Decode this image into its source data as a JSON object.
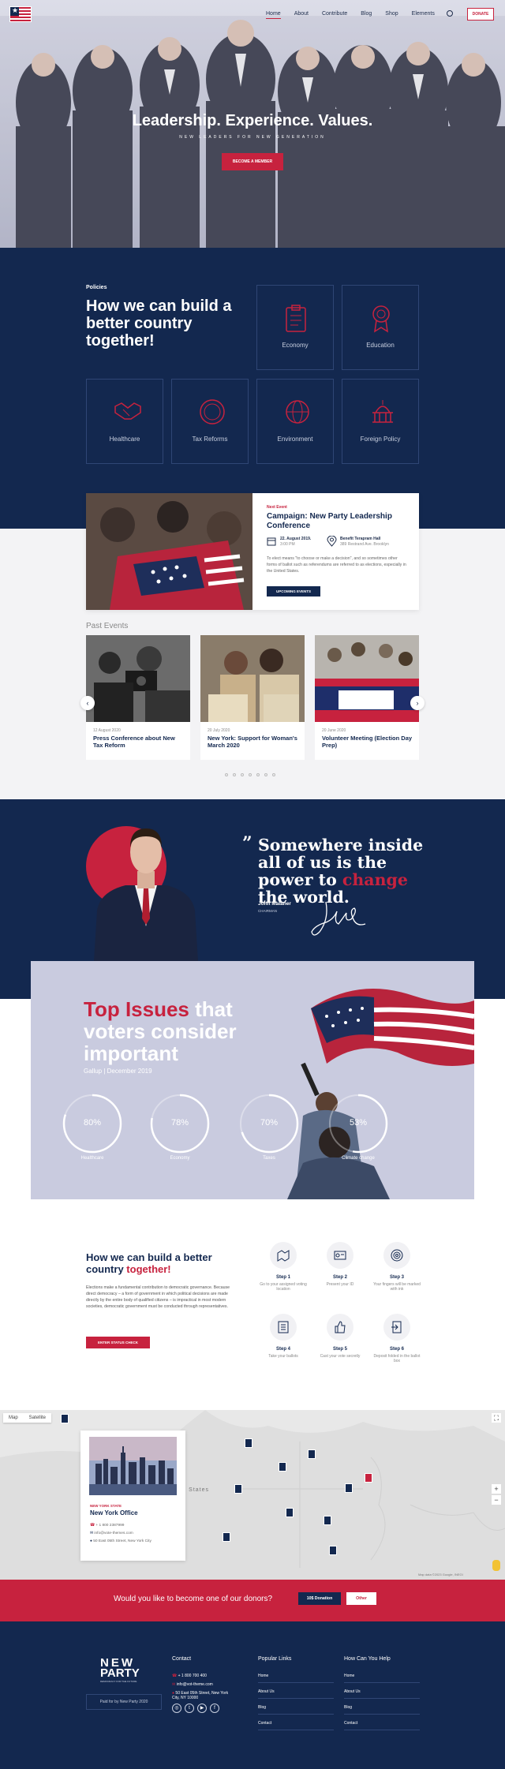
{
  "header": {
    "nav": [
      "Home",
      "About",
      "Contribute",
      "Blog",
      "Shop",
      "Elements"
    ],
    "donate_label": "DONATE"
  },
  "hero": {
    "title": "Leadership. Experience. Values.",
    "subtitle": "NEW LEADERS FOR NEW GENERATION",
    "button": "BECOME A MEMBER"
  },
  "policies": {
    "label": "Policies",
    "title": "How we can build a better country together!",
    "items": [
      "Economy",
      "Education",
      "Healthcare",
      "Tax Reforms",
      "Environment",
      "Foreign Policy"
    ]
  },
  "event": {
    "label": "Next Event",
    "title": "Campaign: New Party Leadership Conference",
    "date": "22. August 2019.",
    "time": "3:00 PM",
    "location": "Benefit Terapram Hall",
    "address": "389 Restrand Ave. Brooklyn",
    "description": "To elect means \"to choose or make a decision\", and so sometimes other forms of ballot such as referendums are referred to as elections, especially in the United States.",
    "button": "UPCOMING EVENTS"
  },
  "past_events": {
    "title": "Past Events",
    "items": [
      {
        "date": "12 August 2020",
        "title": "Press Conference about New Tax Reform"
      },
      {
        "date": "20 July 2020",
        "title": "New York: Support for Woman's March 2020"
      },
      {
        "date": "20 June 2020",
        "title": "Volunteer Meeting (Election Day Prep)"
      }
    ]
  },
  "quote": {
    "line1": "Somewhere inside all of us is the power to",
    "highlight": "change",
    "line2": "the world.",
    "name": "John Malaner",
    "role": "CHAIRMAN"
  },
  "issues": {
    "title_red": "Top Issues",
    "title_rest": "that voters consider important",
    "source": "Gallup | December 2019",
    "rings": [
      {
        "value": "80%",
        "pct": 0.8,
        "name": "Healthcare"
      },
      {
        "value": "78%",
        "pct": 0.78,
        "name": "Economy"
      },
      {
        "value": "70%",
        "pct": 0.7,
        "name": "Taxes"
      },
      {
        "value": "53%",
        "pct": 0.53,
        "name": "Climate change"
      }
    ]
  },
  "build": {
    "title": "How we can build a better country",
    "title_red": "together!",
    "description": "Elections make a fundamental contribution to democratic governance. Because direct democracy – a form of government in which political decisions are made directly by the entire body of qualified citizens – is impractical in most modern societies, democratic government must be conducted through representatives.",
    "button": "ENTER STATUS CHECK",
    "steps": [
      {
        "title": "Step 1",
        "text": "Go to your assigned voting location"
      },
      {
        "title": "Step 2",
        "text": "Present your ID"
      },
      {
        "title": "Step 3",
        "text": "Your fingers will be marked with ink"
      },
      {
        "title": "Step 4",
        "text": "Take your ballots"
      },
      {
        "title": "Step 5",
        "text": "Cast your vote secretly"
      },
      {
        "title": "Step 6",
        "text": "Deposit folded in the ballot box"
      }
    ]
  },
  "map": {
    "tabs": [
      "Map",
      "Satellite"
    ],
    "office_label": "NEW YORK STATE",
    "office_title": "New York Office",
    "phone": "+ 1 800 2387999",
    "email": "info@vote-themes.com",
    "address": "50 East 05th Street, New York City",
    "map_label": "United States",
    "attribution": "Map data ©2023 Google, INEGI"
  },
  "donor": {
    "text": "Would you like to become one of our donors?",
    "btn1": "10$ Donation",
    "btn2": "Other"
  },
  "footer": {
    "logo_line1": "NEW",
    "logo_line2": "PARTY",
    "logo_sub": "DEMOCRACY FOR THE FUTURE",
    "paid": "Paid for by New Party 2020",
    "contact_h": "Contact",
    "phone": "+ 1 800 700 400",
    "email": "info@vot-theme.com",
    "address": "50 East 05th Street, New York City, NY 10000",
    "links_h": "Popular Links",
    "links": [
      "Home",
      "About Us",
      "Blog",
      "Contact"
    ],
    "help_h": "How Can You Help",
    "help": [
      "Home",
      "About Us",
      "Blog",
      "Contact"
    ]
  },
  "colors": {
    "navy": "#13284f",
    "red": "#c7223e",
    "lavender": "#c9cbdf"
  }
}
